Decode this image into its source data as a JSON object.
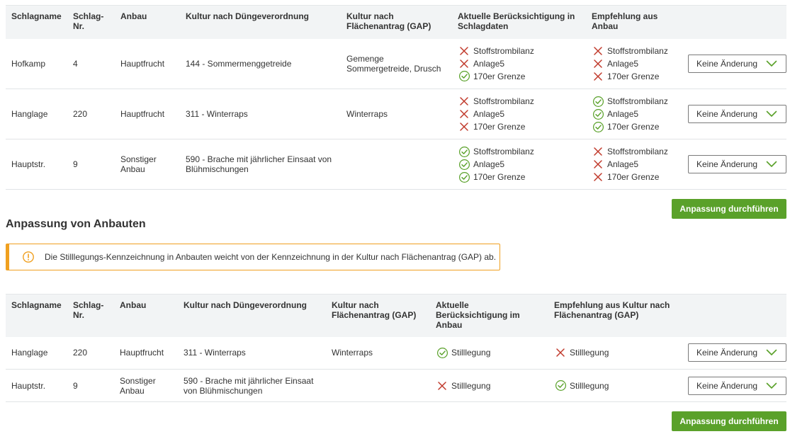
{
  "table1": {
    "headers": [
      "Schlagname",
      "Schlag-\nNr.",
      "Anbau",
      "Kultur nach Düngeverordnung",
      "Kultur nach\nFlächenantrag (GAP)",
      "Aktuelle Berücksichtigung in\nSchlagdaten",
      "Empfehlung aus\nAnbau"
    ],
    "rows": [
      {
        "schlagname": "Hofkamp",
        "nr": "4",
        "anbau": "Hauptfrucht",
        "duev": "144 - Sommermenggetreide",
        "gap": "Gemenge\nSommergetreide, Drusch",
        "aktuell": [
          {
            "label": "Stoffstrombilanz",
            "ok": false
          },
          {
            "label": "Anlage5",
            "ok": false
          },
          {
            "label": "170er Grenze",
            "ok": true
          }
        ],
        "empfehlung": [
          {
            "label": "Stoffstrombilanz",
            "ok": false
          },
          {
            "label": "Anlage5",
            "ok": false
          },
          {
            "label": "170er Grenze",
            "ok": false
          }
        ],
        "select": "Keine Änderung"
      },
      {
        "schlagname": "Hanglage",
        "nr": "220",
        "anbau": "Hauptfrucht",
        "duev": "311 - Winterraps",
        "gap": "Winterraps",
        "aktuell": [
          {
            "label": "Stoffstrombilanz",
            "ok": false
          },
          {
            "label": "Anlage5",
            "ok": false
          },
          {
            "label": "170er Grenze",
            "ok": false
          }
        ],
        "empfehlung": [
          {
            "label": "Stoffstrombilanz",
            "ok": true
          },
          {
            "label": "Anlage5",
            "ok": true
          },
          {
            "label": "170er Grenze",
            "ok": true
          }
        ],
        "select": "Keine Änderung"
      },
      {
        "schlagname": "Hauptstr.",
        "nr": "9",
        "anbau": "Sonstiger\nAnbau",
        "duev": "590 - Brache mit jährlicher Einsaat von\nBlühmischungen",
        "gap": "",
        "aktuell": [
          {
            "label": "Stoffstrombilanz",
            "ok": true
          },
          {
            "label": "Anlage5",
            "ok": true
          },
          {
            "label": "170er Grenze",
            "ok": true
          }
        ],
        "empfehlung": [
          {
            "label": "Stoffstrombilanz",
            "ok": false
          },
          {
            "label": "Anlage5",
            "ok": false
          },
          {
            "label": "170er Grenze",
            "ok": false
          }
        ],
        "select": "Keine Änderung"
      }
    ],
    "button": "Anpassung durchführen"
  },
  "section2": {
    "title": "Anpassung von Anbauten",
    "warning": "Die Stilllegungs-Kennzeichnung in Anbauten weicht von der Kennzeichnung in der Kultur nach Flächenantrag (GAP) ab."
  },
  "table2": {
    "headers": [
      "Schlagname",
      "Schlag-\nNr.",
      "Anbau",
      "Kultur nach Düngeverordnung",
      "Kultur nach\nFlächenantrag (GAP)",
      "Aktuelle\nBerücksichtigung im\nAnbau",
      "Empfehlung aus Kultur nach\nFlächenantrag (GAP)"
    ],
    "rows": [
      {
        "schlagname": "Hanglage",
        "nr": "220",
        "anbau": "Hauptfrucht",
        "duev": "311 - Winterraps",
        "gap": "Winterraps",
        "aktuell": [
          {
            "label": "Stilllegung",
            "ok": true
          }
        ],
        "empfehlung": [
          {
            "label": "Stilllegung",
            "ok": false
          }
        ],
        "select": "Keine Änderung"
      },
      {
        "schlagname": "Hauptstr.",
        "nr": "9",
        "anbau": "Sonstiger\nAnbau",
        "duev": "590 - Brache mit jährlicher Einsaat\nvon Blühmischungen",
        "gap": "",
        "aktuell": [
          {
            "label": "Stilllegung",
            "ok": false
          }
        ],
        "empfehlung": [
          {
            "label": "Stilllegung",
            "ok": true
          }
        ],
        "select": "Keine Änderung"
      }
    ],
    "button": "Anpassung durchführen"
  },
  "icons": {
    "ok": "check-circle-icon",
    "not_ok": "x-icon",
    "select": "chevron-down-icon",
    "warning": "exclamation-circle-icon"
  },
  "colors": {
    "ok": "#5aa12a",
    "not_ok": "#c0392b",
    "button": "#5aa12a",
    "warning": "#f0a020"
  }
}
